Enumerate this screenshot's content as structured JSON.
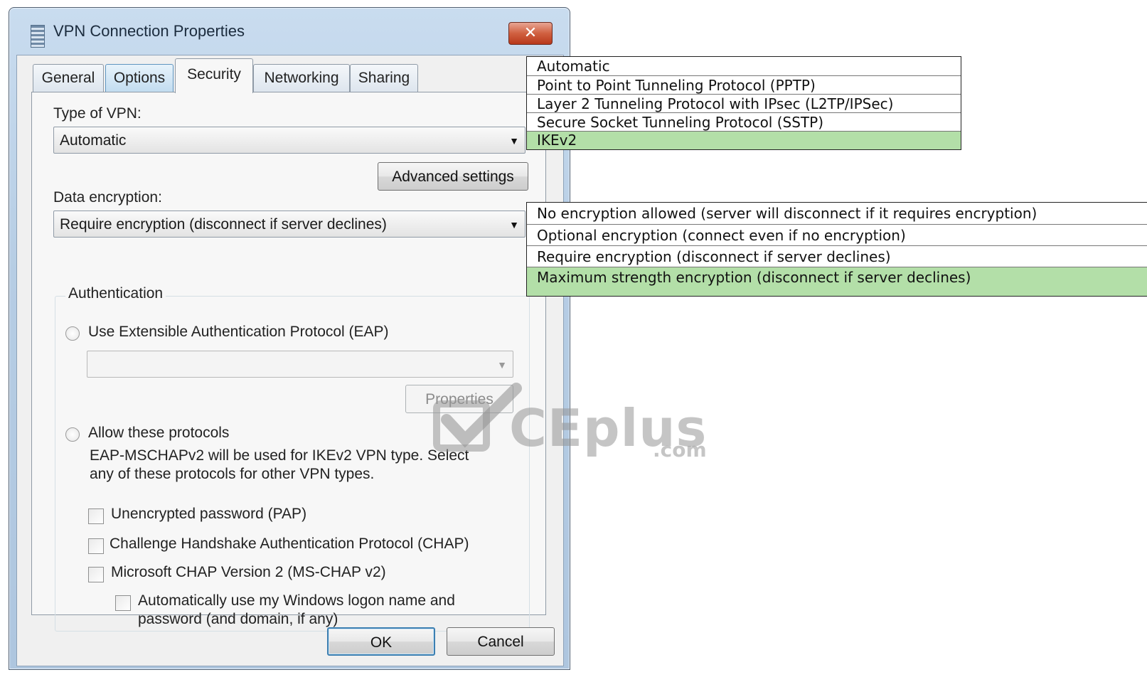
{
  "window": {
    "title": "VPN Connection Properties",
    "close_glyph": "✕"
  },
  "tabs": [
    {
      "label": "General",
      "active": false
    },
    {
      "label": "Options",
      "active": false
    },
    {
      "label": "Security",
      "active": true
    },
    {
      "label": "Networking",
      "active": false
    },
    {
      "label": "Sharing",
      "active": false
    }
  ],
  "security": {
    "vpn_type_label": "Type of VPN:",
    "vpn_type_value": "Automatic",
    "advanced_button": "Advanced settings",
    "data_encryption_label": "Data encryption:",
    "data_encryption_value": "Require encryption (disconnect if server declines)",
    "auth_group_title": "Authentication",
    "eap_radio_label": "Use Extensible Authentication Protocol (EAP)",
    "eap_combo_value": "",
    "properties_button": "Properties",
    "allow_radio_label": "Allow these protocols",
    "allow_note_line1": "EAP-MSCHAPv2 will be used for IKEv2 VPN type. Select",
    "allow_note_line2": "any of these protocols for other VPN types.",
    "checkboxes": [
      {
        "label": "Unencrypted password (PAP)",
        "checked": false
      },
      {
        "label": "Challenge Handshake Authentication Protocol (CHAP)",
        "checked": false
      },
      {
        "label": "Microsoft CHAP Version 2 (MS-CHAP v2)",
        "checked": false
      }
    ],
    "auto_logon_line1": "Automatically use my Windows logon name and",
    "auto_logon_line2": "password (and domain, if any)",
    "auto_logon_checked": false
  },
  "footer": {
    "ok": "OK",
    "cancel": "Cancel"
  },
  "vpn_type_options": [
    {
      "label": "Automatic",
      "selected": false
    },
    {
      "label": "Point to Point Tunneling Protocol (PPTP)",
      "selected": false
    },
    {
      "label": "Layer 2 Tunneling Protocol with IPsec (L2TP/IPSec)",
      "selected": false
    },
    {
      "label": "Secure Socket Tunneling Protocol (SSTP)",
      "selected": false
    },
    {
      "label": "IKEv2",
      "selected": true
    }
  ],
  "encryption_options": [
    {
      "label": "No encryption allowed (server will disconnect if it requires encryption)",
      "selected": false
    },
    {
      "label": "Optional encryption (connect even if no encryption)",
      "selected": false
    },
    {
      "label": "Require encryption (disconnect if server declines)",
      "selected": false
    },
    {
      "label": "Maximum strength encryption (disconnect if server declines)",
      "selected": true
    }
  ],
  "watermark": {
    "brand": "CEplus",
    "suffix": ".com"
  },
  "colors": {
    "selected_highlight": "#b3dfa8",
    "title_bar": "#c9dcef",
    "close_button": "#d06040"
  }
}
